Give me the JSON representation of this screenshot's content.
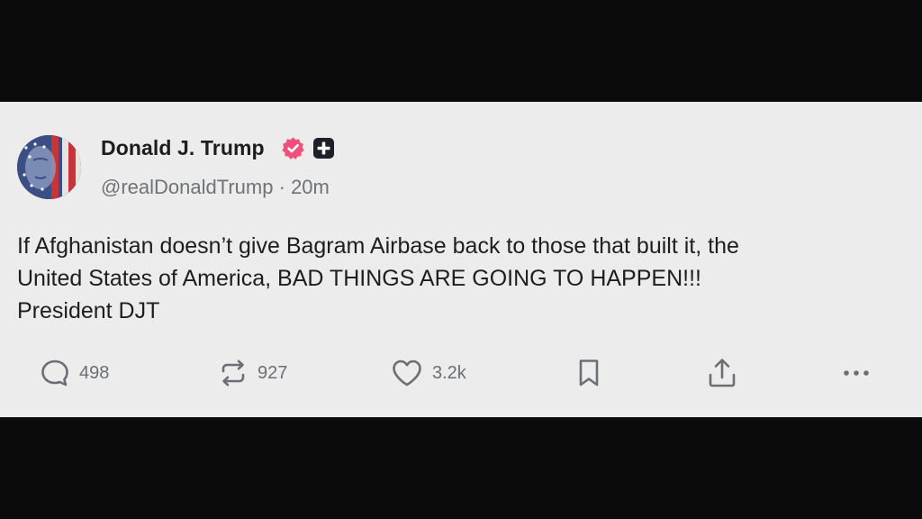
{
  "post": {
    "author": {
      "name": "Donald J. Trump",
      "handle": "@realDonaldTrump",
      "separator": "·",
      "time": "20m"
    },
    "text_lines": [
      "If Afghanistan doesn’t give Bagram Airbase back to those that built it, the",
      "United States of America, BAD THINGS ARE GOING TO HAPPEN!!!",
      "President DJT"
    ],
    "actions": {
      "replies": "498",
      "reposts": "927",
      "likes": "3.2k"
    }
  },
  "colors": {
    "card_background": "#ececec",
    "letterbox": "#0b0b0b",
    "verified_badge": "#f0507a",
    "icon_gray": "#6b6e74"
  },
  "icons": [
    "reply-icon",
    "repost-icon",
    "like-icon",
    "bookmark-icon",
    "share-icon",
    "more-icon",
    "verified-icon",
    "plus-badge-icon"
  ]
}
